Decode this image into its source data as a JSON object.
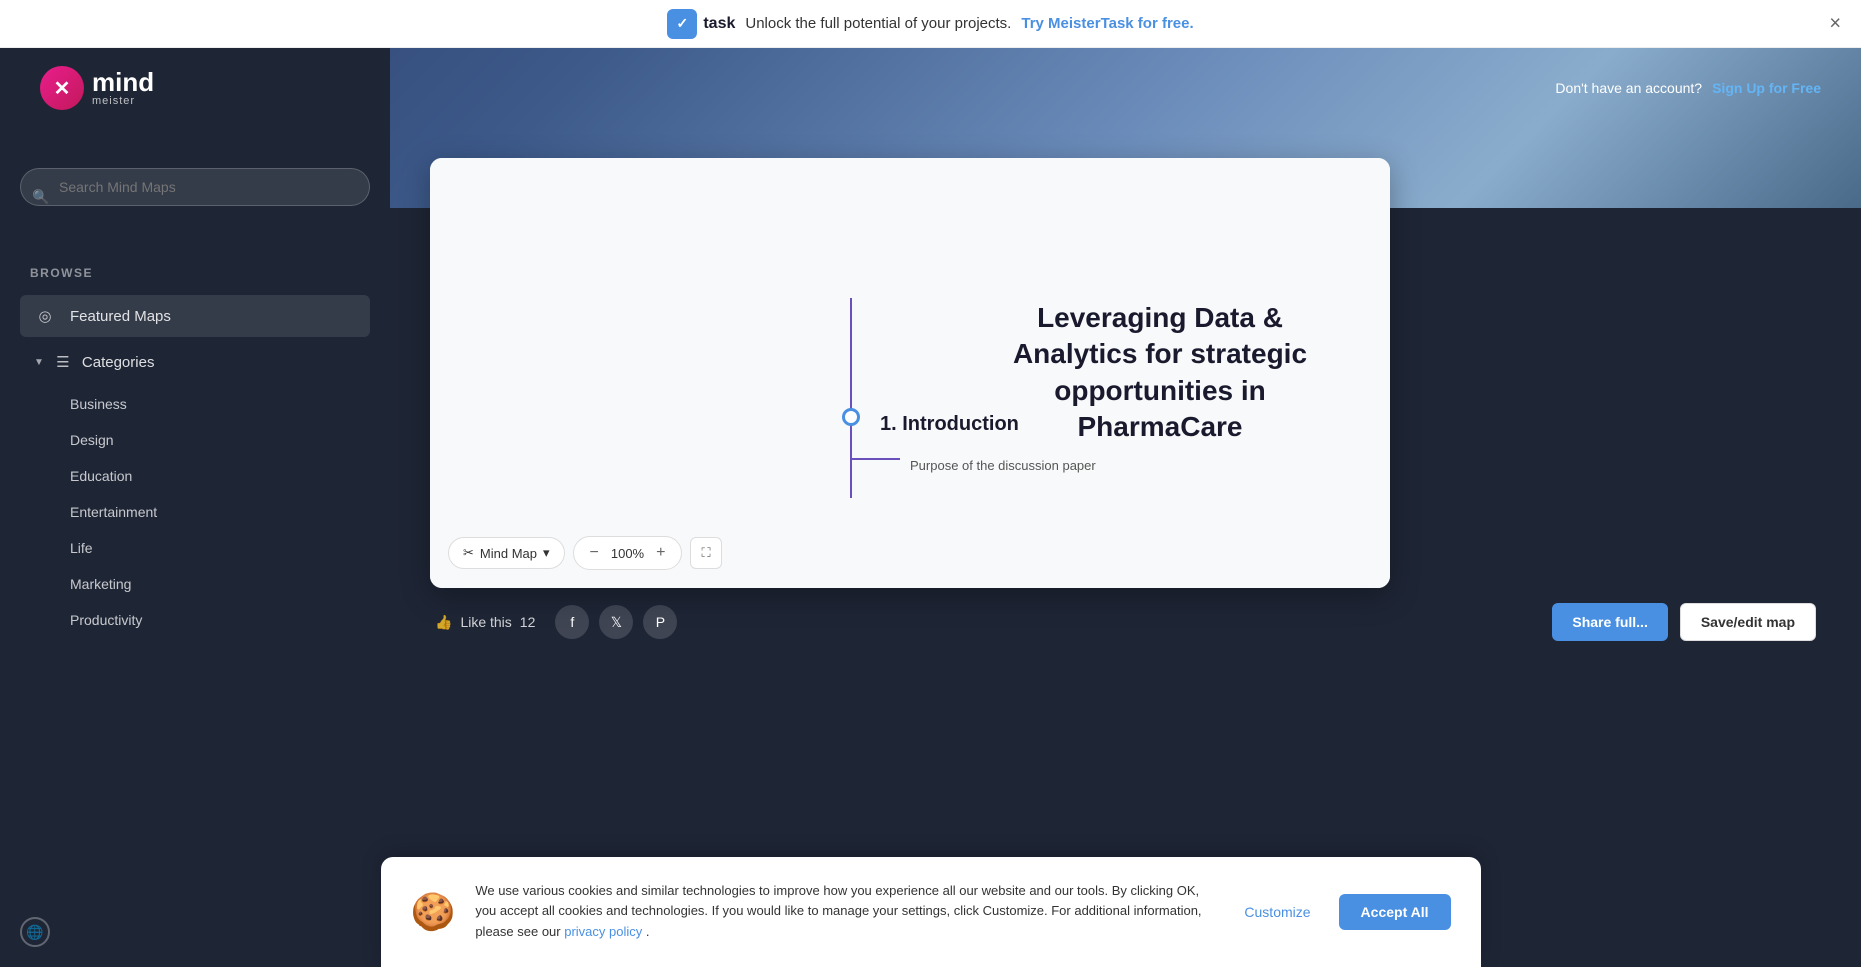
{
  "banner": {
    "text": "Unlock the full potential of your projects.",
    "link_text": "Try MeisterTask for free.",
    "task_label": "task",
    "close_label": "×"
  },
  "header": {
    "logo_mind": "mind",
    "logo_meister": "meister",
    "no_account_text": "Don't have an account?",
    "signup_text": "Sign Up for Free"
  },
  "sidebar": {
    "browse_label": "BROWSE",
    "search_placeholder": "Search Mind Maps",
    "featured_maps_label": "Featured Maps",
    "categories_label": "Categories",
    "sub_items": [
      {
        "label": "Business"
      },
      {
        "label": "Design"
      },
      {
        "label": "Education"
      },
      {
        "label": "Entertainment"
      },
      {
        "label": "Life"
      },
      {
        "label": "Marketing"
      },
      {
        "label": "Productivity"
      }
    ]
  },
  "map": {
    "title": "Leveraging Data & Analytics for strategic opportunities in PharmaCare",
    "intro_label": "1. Introduction",
    "sub_label": "Purpose of the discussion paper",
    "map_type": "Mind Map",
    "zoom_level": "100%",
    "zoom_minus": "−",
    "zoom_plus": "+",
    "fullscreen_icon": "⛶"
  },
  "action_bar": {
    "like_text": "Like this",
    "like_count": "12",
    "share_full_label": "Share full...",
    "edit_map_label": "Save/edit map"
  },
  "cookie": {
    "icon": "🍪",
    "text": "We use various cookies and similar technologies to improve how you experience all our website and our tools. By clicking OK, you accept all cookies and technologies. If you would like to manage your settings, click Customize. For additional information, please see our ",
    "link_text": "privacy policy",
    "link_end": ".",
    "customize_label": "Customize",
    "accept_label": "Accept All"
  }
}
